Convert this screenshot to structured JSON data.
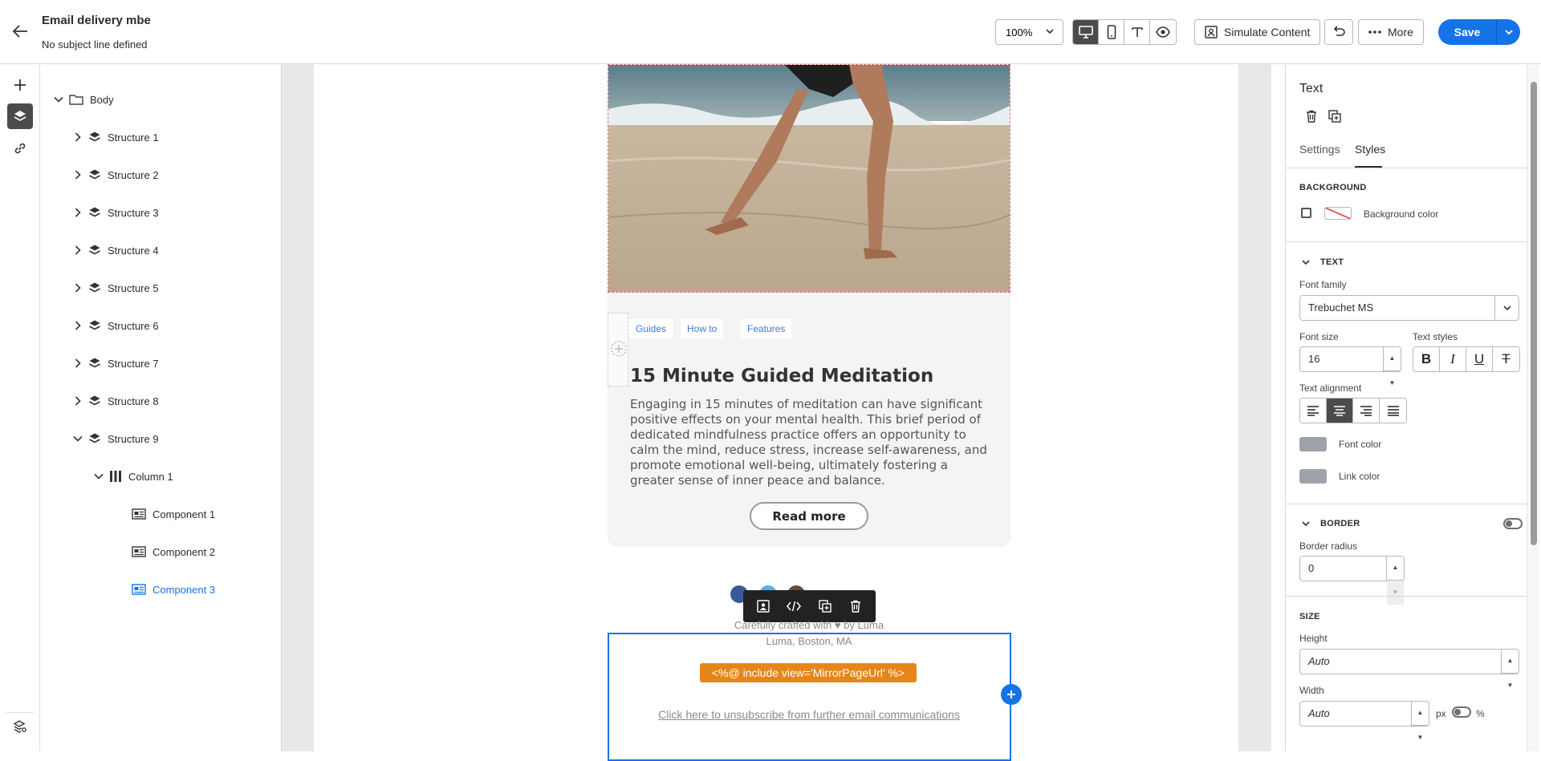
{
  "header": {
    "title": "Email delivery mbe",
    "subtitle": "No subject line defined",
    "zoom": "100%",
    "simulate_label": "Simulate Content",
    "more_label": "More",
    "save_label": "Save"
  },
  "tree": {
    "body_label": "Body",
    "structures": [
      "Structure 1",
      "Structure 2",
      "Structure 3",
      "Structure 4",
      "Structure 5",
      "Structure 6",
      "Structure 7",
      "Structure 8",
      "Structure 9"
    ],
    "column_label": "Column 1",
    "components": [
      "Component 1",
      "Component 2",
      "Component 3"
    ],
    "selected": "Component 3"
  },
  "canvas": {
    "tags": [
      "Guides",
      "How to",
      "Features"
    ],
    "card_title": "15 Minute Guided Meditation",
    "card_text": "Engaging in 15 minutes of meditation can have significant positive effects on your mental health. This brief period of dedicated mindfulness practice offers an opportunity to calm the mind, reduce stress, increase self-awareness, and promote emotional well-being, ultimately fostering a greater sense of inner peace and balance.",
    "read_more": "Read more",
    "crafted_text": "Carefully crafted with ♥ by Luma",
    "address_text": "Luma, Boston, MA",
    "include_tag": "<%@ include view='MirrorPageUrl' %>",
    "unsubscribe_text": "Click here to unsubscribe from further email communications"
  },
  "panel": {
    "title": "Text",
    "tabs": [
      "Settings",
      "Styles"
    ],
    "active_tab": "Styles",
    "background_section": "BACKGROUND",
    "background_color_label": "Background color",
    "text_section": "TEXT",
    "font_family_label": "Font family",
    "font_family_value": "Trebuchet MS",
    "font_size_label": "Font size",
    "font_size_value": "16",
    "text_styles_label": "Text styles",
    "text_alignment_label": "Text alignment",
    "font_color_label": "Font color",
    "link_color_label": "Link color",
    "border_section": "BORDER",
    "border_radius_label": "Border radius",
    "border_radius_value": "0",
    "size_section": "SIZE",
    "height_label": "Height",
    "height_value": "Auto",
    "width_label": "Width",
    "width_value": "Auto",
    "unit_px": "px",
    "unit_percent": "%"
  },
  "colors": {
    "accent": "#1473e6",
    "include_tag": "#e68619",
    "swatch": "#9ea3ab"
  }
}
